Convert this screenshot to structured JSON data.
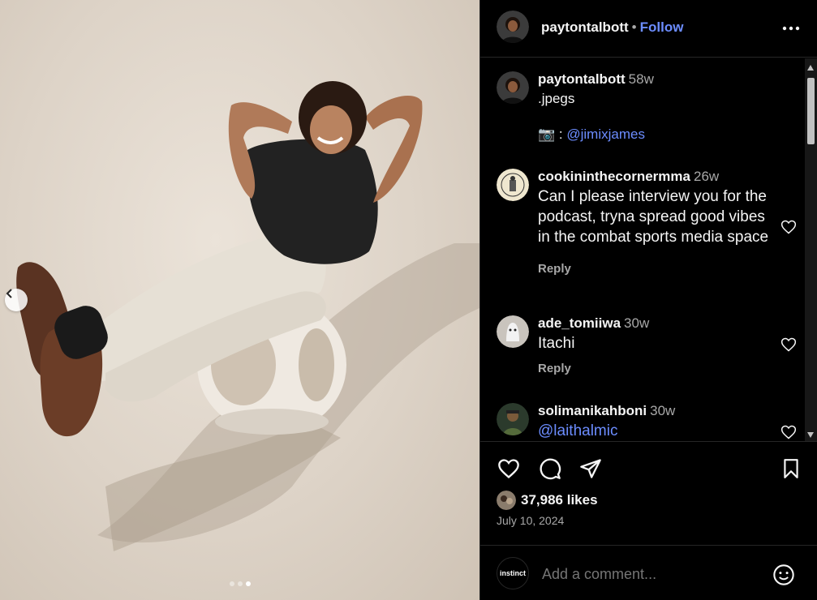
{
  "post": {
    "username": "paytontalbott",
    "follow_label": "Follow",
    "separator": "•"
  },
  "caption": {
    "username": "paytontalbott",
    "time": "58w",
    "line1": ".jpegs",
    "camera_prefix": "📷 :",
    "mention": "@jimixjames"
  },
  "comments": [
    {
      "username": "cookininthecornermma",
      "time": "26w",
      "text": "Can I please interview you for the podcast, tryna spread good vibes in the combat sports media space",
      "reply_label": "Reply"
    },
    {
      "username": "ade_tomiiwa",
      "time": "30w",
      "text": "Itachi",
      "reply_label": "Reply"
    },
    {
      "username": "solimanikahboni",
      "time": "30w",
      "text": "@laithalmic"
    }
  ],
  "likes": "37,986 likes",
  "date": "July 10, 2024",
  "add_comment": {
    "placeholder": "Add a comment...",
    "avatar_text": "instinct"
  },
  "carousel": {
    "count": 3,
    "active_index": 2
  },
  "colors": {
    "background": "#000000",
    "link": "#6c8dff",
    "muted": "#a8a8a8",
    "border": "#262626"
  },
  "icons": [
    "chevron-left-icon",
    "more-icon",
    "heart-icon",
    "comment-icon",
    "share-icon",
    "bookmark-icon",
    "emoji-icon",
    "camera-icon"
  ]
}
